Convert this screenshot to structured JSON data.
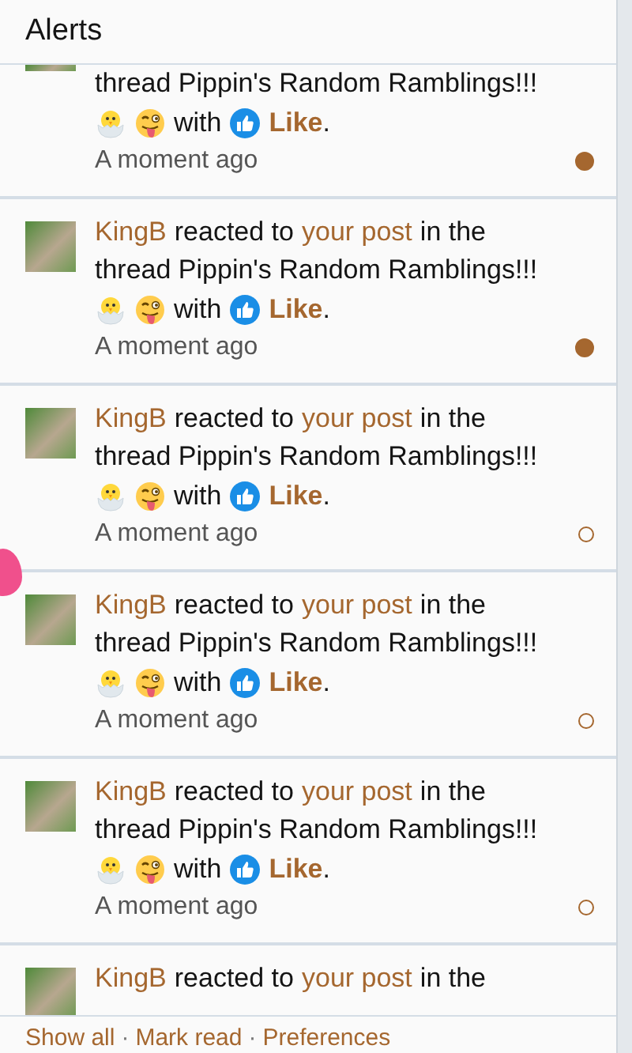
{
  "header": {
    "title": "Alerts"
  },
  "alerts": [
    {
      "kind": "clipped_top",
      "lines": [
        [
          {
            "kind": "plain",
            "text": "thread Pippin's Random Ramblings!!!"
          }
        ],
        [
          {
            "kind": "chick"
          },
          {
            "kind": "tongue_face"
          },
          {
            "kind": "plain",
            "text": "with"
          },
          {
            "kind": "like"
          },
          {
            "kind": "reaction",
            "text": "Like"
          },
          {
            "kind": "punct",
            "text": "."
          }
        ]
      ],
      "time": "A moment ago",
      "read": false
    },
    {
      "kind": "full",
      "lines": [
        [
          {
            "kind": "user",
            "text": "KingB"
          },
          {
            "kind": "plain",
            "text": "reacted to"
          },
          {
            "kind": "link",
            "text": "your post"
          },
          {
            "kind": "plain",
            "text": "in the"
          }
        ],
        [
          {
            "kind": "plain",
            "text": "thread Pippin's Random Ramblings!!!"
          }
        ],
        [
          {
            "kind": "chick"
          },
          {
            "kind": "tongue_face"
          },
          {
            "kind": "plain",
            "text": "with"
          },
          {
            "kind": "like"
          },
          {
            "kind": "reaction",
            "text": "Like"
          },
          {
            "kind": "punct",
            "text": "."
          }
        ]
      ],
      "time": "A moment ago",
      "read": false
    },
    {
      "kind": "full",
      "lines": [
        [
          {
            "kind": "user",
            "text": "KingB"
          },
          {
            "kind": "plain",
            "text": "reacted to"
          },
          {
            "kind": "link",
            "text": "your post"
          },
          {
            "kind": "plain",
            "text": "in the"
          }
        ],
        [
          {
            "kind": "plain",
            "text": "thread Pippin's Random Ramblings!!!"
          }
        ],
        [
          {
            "kind": "chick"
          },
          {
            "kind": "tongue_face"
          },
          {
            "kind": "plain",
            "text": "with"
          },
          {
            "kind": "like"
          },
          {
            "kind": "reaction",
            "text": "Like"
          },
          {
            "kind": "punct",
            "text": "."
          }
        ]
      ],
      "time": "A moment ago",
      "read": true
    },
    {
      "kind": "full",
      "lines": [
        [
          {
            "kind": "user",
            "text": "KingB"
          },
          {
            "kind": "plain",
            "text": "reacted to"
          },
          {
            "kind": "link",
            "text": "your post"
          },
          {
            "kind": "plain",
            "text": "in the"
          }
        ],
        [
          {
            "kind": "plain",
            "text": "thread Pippin's Random Ramblings!!!"
          }
        ],
        [
          {
            "kind": "chick"
          },
          {
            "kind": "tongue_face"
          },
          {
            "kind": "plain",
            "text": "with"
          },
          {
            "kind": "like"
          },
          {
            "kind": "reaction",
            "text": "Like"
          },
          {
            "kind": "punct",
            "text": "."
          }
        ]
      ],
      "time": "A moment ago",
      "read": true
    },
    {
      "kind": "full",
      "lines": [
        [
          {
            "kind": "user",
            "text": "KingB"
          },
          {
            "kind": "plain",
            "text": "reacted to"
          },
          {
            "kind": "link",
            "text": "your post"
          },
          {
            "kind": "plain",
            "text": "in the"
          }
        ],
        [
          {
            "kind": "plain",
            "text": "thread Pippin's Random Ramblings!!!"
          }
        ],
        [
          {
            "kind": "chick"
          },
          {
            "kind": "tongue_face"
          },
          {
            "kind": "plain",
            "text": "with"
          },
          {
            "kind": "like"
          },
          {
            "kind": "reaction",
            "text": "Like"
          },
          {
            "kind": "punct",
            "text": "."
          }
        ]
      ],
      "time": "A moment ago",
      "read": true
    },
    {
      "kind": "clipped_bottom",
      "lines": [
        [
          {
            "kind": "user",
            "text": "KingB"
          },
          {
            "kind": "plain",
            "text": "reacted to"
          },
          {
            "kind": "link",
            "text": "your post"
          },
          {
            "kind": "plain",
            "text": "in the"
          }
        ]
      ]
    }
  ],
  "footer": {
    "links": [
      "Show all",
      "Mark read",
      "Preferences"
    ],
    "separator": "·"
  }
}
